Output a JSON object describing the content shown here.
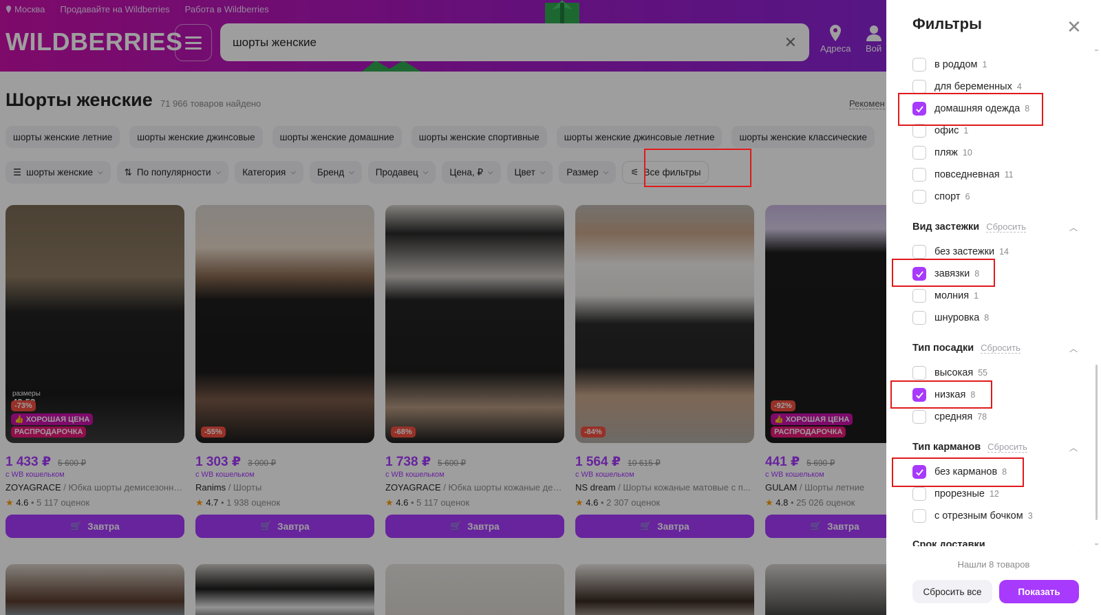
{
  "header": {
    "city": "Москва",
    "sell_link": "Продавайте на Wildberries",
    "work_link": "Работа в Wildberries",
    "logo": "WILDBERRIES",
    "search_value": "шорты женские",
    "addresses_label": "Адреса",
    "login_label": "Вой"
  },
  "page": {
    "title": "Шорты женские",
    "found": "71 966 товаров найдено",
    "sort_link": "Рекомен"
  },
  "chips": [
    "шорты женские летние",
    "шорты женские джинсовые",
    "шорты женские домашние",
    "шорты женские спортивные",
    "шорты женские джинсовые летние",
    "шорты женские классические"
  ],
  "filter_bar": {
    "category_search": "шорты женские",
    "sort": "По популярности",
    "category": "Категория",
    "brand": "Бренд",
    "seller": "Продавец",
    "price": "Цена, ₽",
    "color": "Цвет",
    "size": "Размер",
    "all_filters": "Все фильтры"
  },
  "products": [
    {
      "price": "1 433 ₽",
      "old_price": "5 600 ₽",
      "wallet": "с WB кошельком",
      "brand": "ZOYAGRACE",
      "name": " / Юбка шорты демисезонны...",
      "rating": "4.6",
      "reviews": " • 5 117 оценок",
      "discount": "-73%",
      "badge_good": "👍 ХОРОШАЯ ЦЕНА",
      "badge_sale": "РАСПРОДАРОЧКА",
      "sizes_note": "размеры",
      "sizes": "42-58",
      "cart": "Завтра"
    },
    {
      "price": "1 303 ₽",
      "old_price": "3 000 ₽",
      "wallet": "с WB кошельком",
      "brand": "Ranims",
      "name": " / Шорты",
      "rating": "4.7",
      "reviews": " • 1 938 оценок",
      "discount": "-55%",
      "cart": "Завтра"
    },
    {
      "price": "1 738 ₽",
      "old_price": "5 600 ₽",
      "wallet": "с WB кошельком",
      "brand": "ZOYAGRACE",
      "name": " / Юбка шорты кожаные дем...",
      "rating": "4.6",
      "reviews": " • 5 117 оценок",
      "discount": "-68%",
      "cart": "Завтра"
    },
    {
      "price": "1 564 ₽",
      "old_price": "10 615 ₽",
      "wallet": "с WB кошельком",
      "brand": "NS dream",
      "name": " / Шорты кожаные матовые с п...",
      "rating": "4.6",
      "reviews": " • 2 307 оценок",
      "discount": "-84%",
      "cart": "Завтра"
    },
    {
      "price": "441 ₽",
      "old_price": "5 690 ₽",
      "wallet": "с WB кошельком",
      "brand": "GULAM",
      "name": " / Шорты летние",
      "rating": "4.8",
      "reviews": " • 25 026 оценок",
      "discount": "-92%",
      "badge_good": "👍 ХОРОШАЯ ЦЕНА",
      "badge_sale": "РАСПРОДАРОЧКА",
      "cart": "Завтра"
    }
  ],
  "panel": {
    "title": "Фильтры",
    "options_top": [
      {
        "label": "в роддом",
        "count": "1",
        "checked": false
      },
      {
        "label": "для беременных",
        "count": "4",
        "checked": false
      },
      {
        "label": "домашняя одежда",
        "count": "8",
        "checked": true
      },
      {
        "label": "офис",
        "count": "1",
        "checked": false
      },
      {
        "label": "пляж",
        "count": "10",
        "checked": false
      },
      {
        "label": "повседневная",
        "count": "11",
        "checked": false
      },
      {
        "label": "спорт",
        "count": "6",
        "checked": false
      }
    ],
    "closure": {
      "title": "Вид застежки",
      "reset": "Сбросить",
      "options": [
        {
          "label": "без застежки",
          "count": "14",
          "checked": false
        },
        {
          "label": "завязки",
          "count": "8",
          "checked": true
        },
        {
          "label": "молния",
          "count": "1",
          "checked": false
        },
        {
          "label": "шнуровка",
          "count": "8",
          "checked": false
        }
      ]
    },
    "fit": {
      "title": "Тип посадки",
      "reset": "Сбросить",
      "options": [
        {
          "label": "высокая",
          "count": "55",
          "checked": false
        },
        {
          "label": "низкая",
          "count": "8",
          "checked": true
        },
        {
          "label": "средняя",
          "count": "78",
          "checked": false
        }
      ]
    },
    "pockets": {
      "title": "Тип карманов",
      "reset": "Сбросить",
      "options": [
        {
          "label": "без карманов",
          "count": "8",
          "checked": true
        },
        {
          "label": "прорезные",
          "count": "12",
          "checked": false
        },
        {
          "label": "с отрезным бочком",
          "count": "3",
          "checked": false
        }
      ]
    },
    "delivery_title": "Срок доставки",
    "found_text": "Нашли 8 товаров",
    "reset_all": "Сбросить все",
    "show": "Показать"
  },
  "colors": {
    "brand_gradient_start": "#cb11ab",
    "brand_gradient_end": "#7d2ae0",
    "accent": "#a73afd",
    "highlight_box": "#e0191b"
  }
}
